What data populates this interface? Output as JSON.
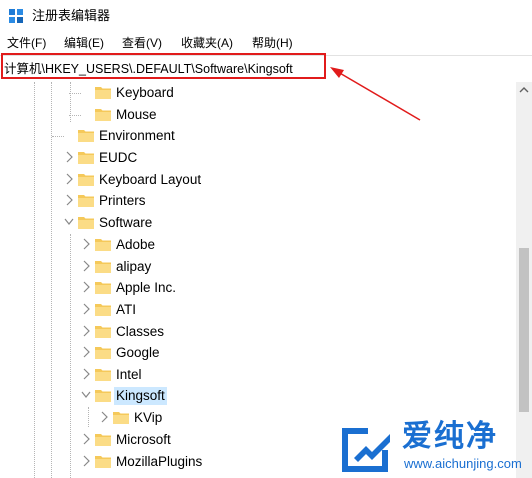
{
  "window": {
    "title": "注册表编辑器",
    "menu": [
      "文件(F)",
      "编辑(E)",
      "查看(V)",
      "收藏夹(A)",
      "帮助(H)"
    ]
  },
  "address": {
    "path": "计算机\\HKEY_USERS\\.DEFAULT\\Software\\Kingsoft"
  },
  "tree": {
    "items": [
      {
        "label": "Keyboard",
        "expander": "none"
      },
      {
        "label": "Mouse",
        "expander": "none"
      },
      {
        "label": "Environment",
        "expander": "none"
      },
      {
        "label": "EUDC",
        "expander": "collapsed"
      },
      {
        "label": "Keyboard Layout",
        "expander": "collapsed"
      },
      {
        "label": "Printers",
        "expander": "collapsed"
      },
      {
        "label": "Software",
        "expander": "expanded"
      },
      {
        "label": "Adobe",
        "expander": "collapsed"
      },
      {
        "label": "alipay",
        "expander": "collapsed"
      },
      {
        "label": "Apple Inc.",
        "expander": "collapsed"
      },
      {
        "label": "ATI",
        "expander": "collapsed"
      },
      {
        "label": "Classes",
        "expander": "collapsed"
      },
      {
        "label": "Google",
        "expander": "collapsed"
      },
      {
        "label": "Intel",
        "expander": "collapsed"
      },
      {
        "label": "Kingsoft",
        "expander": "expanded",
        "selected": true
      },
      {
        "label": "KVip",
        "expander": "collapsed"
      },
      {
        "label": "Microsoft",
        "expander": "collapsed"
      },
      {
        "label": "MozillaPlugins",
        "expander": "collapsed"
      }
    ]
  },
  "watermark": {
    "name": "爱纯净",
    "site": "www.aichunjing.com"
  },
  "colors": {
    "highlight": "#e11b1b",
    "folder": "#f5c95a",
    "selection": "#cce8ff",
    "watermark": "#1a6fd1"
  }
}
